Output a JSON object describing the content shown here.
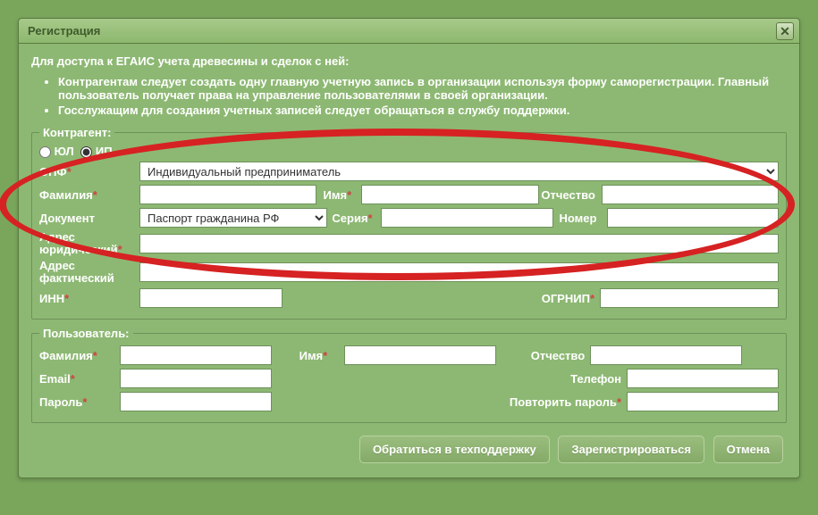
{
  "dialog": {
    "title": "Регистрация"
  },
  "intro": "Для доступа к ЕГАИС учета древесины и сделок с ней:",
  "bullets": [
    "Контрагентам следует создать одну главную учетную запись в организации используя форму саморегистрации. Главный пользователь получает права на управление пользователями в своей организации.",
    "Госслужащим для создания учетных записей следует обращаться в службу поддержки."
  ],
  "contragent": {
    "legend": "Контрагент:",
    "yl": "ЮЛ",
    "ip": "ИП",
    "opf_label": "ОПФ",
    "opf_value": "Индивидуальный предприниматель",
    "surname": "Фамилия",
    "name": "Имя",
    "patronymic": "Отчество",
    "document": "Документ",
    "doc_value": "Паспорт гражданина РФ",
    "series": "Серия",
    "number": "Номер",
    "addr_legal": "Адрес юридический",
    "addr_fact": "Адрес фактический",
    "inn": "ИНН",
    "ogrnip": "ОГРНИП"
  },
  "user": {
    "legend": "Пользователь:",
    "surname": "Фамилия",
    "name": "Имя",
    "patronymic": "Отчество",
    "email": "Email",
    "phone": "Телефон",
    "password": "Пароль",
    "password2": "Повторить пароль"
  },
  "buttons": {
    "support": "Обратиться в техподдержку",
    "register": "Зарегистрироваться",
    "cancel": "Отмена"
  }
}
